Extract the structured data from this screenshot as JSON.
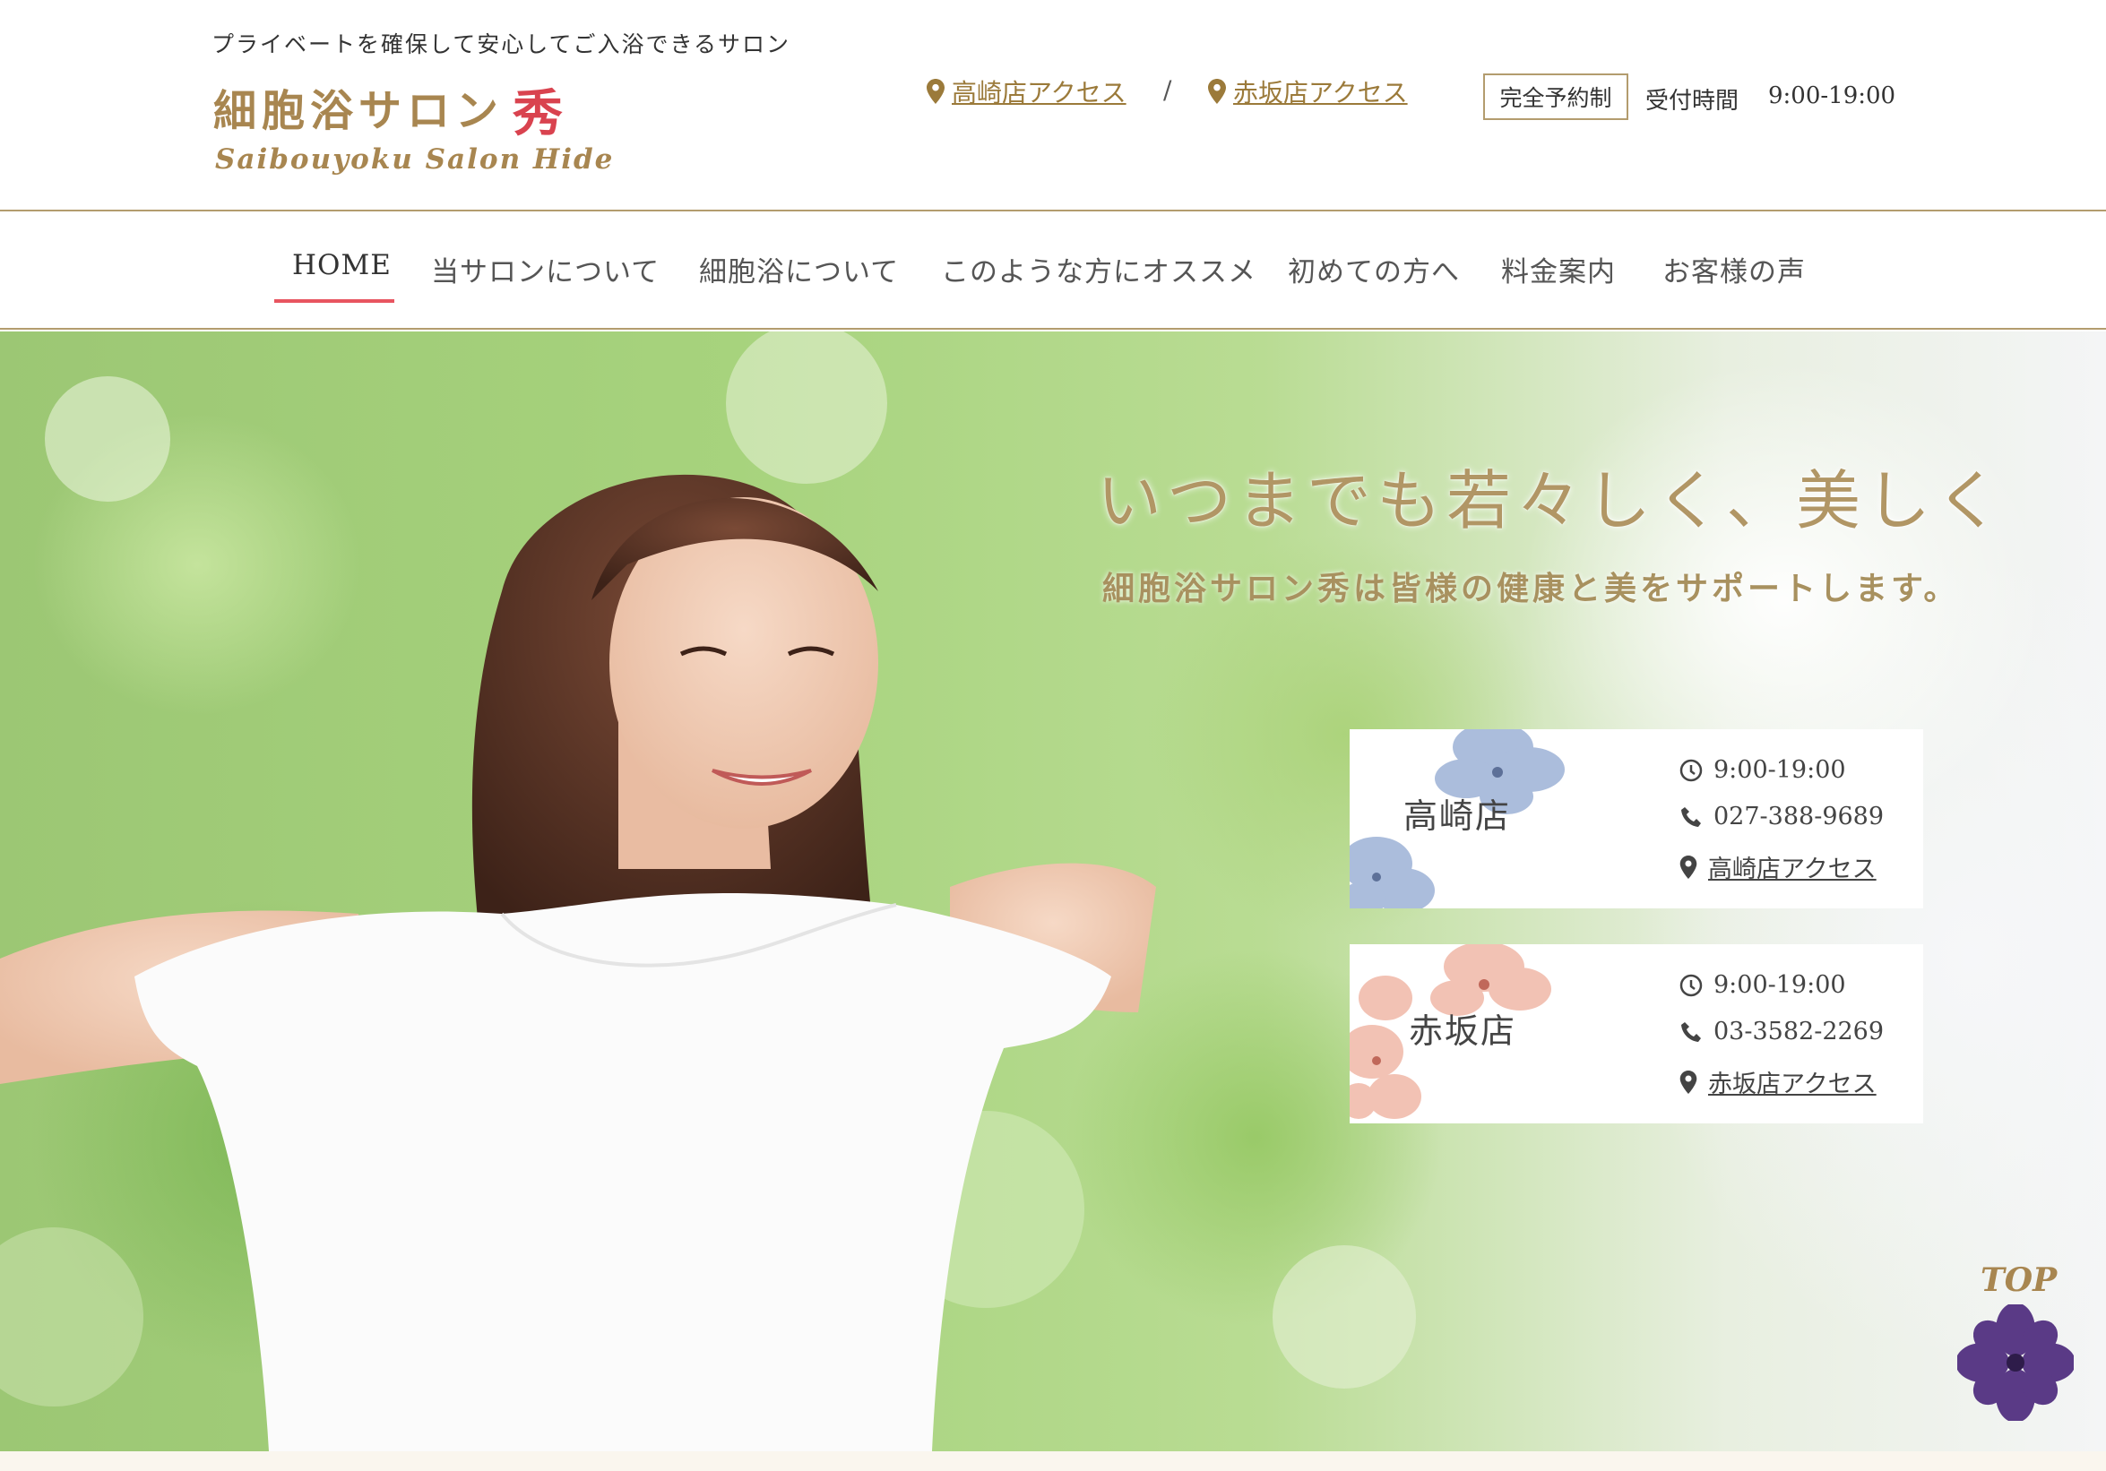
{
  "header": {
    "tagline": "プライベートを確保して安心してご入浴できるサロン",
    "logo_jp": "細胞浴サロン",
    "logo_hide": "秀",
    "logo_en": "Saibouyoku Salon Hide",
    "access_takasaki": "高崎店アクセス",
    "access_separator": "/",
    "access_akasaka": "赤坂店アクセス",
    "reserve_badge": "完全予約制",
    "hours_label": "受付時間",
    "hours_value": "9:00-19:00"
  },
  "nav": {
    "items": [
      {
        "label": "HOME",
        "active": true
      },
      {
        "label": "当サロンについて"
      },
      {
        "label": "細胞浴について"
      },
      {
        "label": "このような方にオススメ"
      },
      {
        "label": "初めての方へ"
      },
      {
        "label": "料金案内"
      },
      {
        "label": "お客様の声"
      }
    ]
  },
  "hero": {
    "headline": "いつまでも若々しく、美しく",
    "subline": "細胞浴サロン秀は皆様の健康と美をサポートします。"
  },
  "stores": [
    {
      "name": "高崎店",
      "hours": "9:00-19:00",
      "phone": "027-388-9689",
      "access": "高崎店アクセス",
      "flower_color": "#9db2d6"
    },
    {
      "name": "赤坂店",
      "hours": "9:00-19:00",
      "phone": "03-3582-2269",
      "access": "赤坂店アクセス",
      "flower_color": "#f0b8a8"
    }
  ],
  "top_button": {
    "label": "TOP",
    "flower_color": "#5a3a86"
  },
  "colors": {
    "gold": "#a88650",
    "accent_red": "#e85560",
    "rule": "#b39c6e"
  }
}
